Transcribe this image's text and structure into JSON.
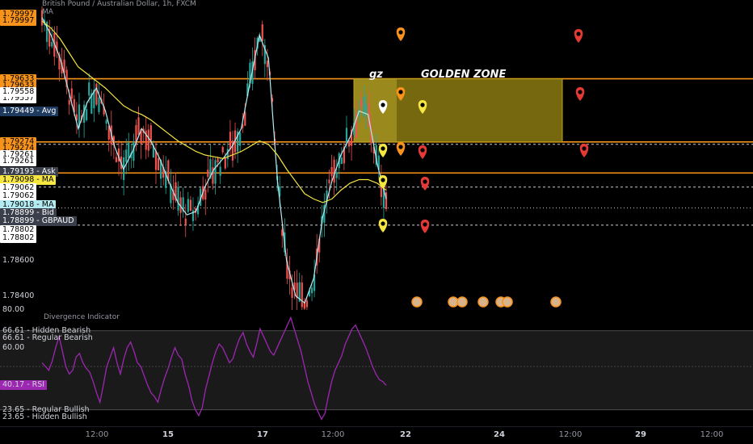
{
  "header": {
    "currency": "AUD",
    "symbol_line": "British Pound / Australian Dollar, 1h, FXCM",
    "ma_label": "MA"
  },
  "zone": {
    "short_label": "gz",
    "label": "GOLDEN ZONE",
    "fill": "#8a7a10",
    "border": "#f7931a"
  },
  "price_axis": {
    "labels": [
      {
        "text": "1.79997",
        "value": 1.79997,
        "bg": "#f7931a",
        "fg": "#000"
      },
      {
        "text": "1.79997",
        "value": 1.7996,
        "bg": "#f7931a",
        "fg": "#000"
      },
      {
        "text": "1.79633",
        "value": 1.79633,
        "bg": "#f7931a",
        "fg": "#000"
      },
      {
        "text": "1.79633",
        "value": 1.79596,
        "bg": "#f7931a",
        "fg": "#000"
      },
      {
        "text": "1.79557",
        "value": 1.7952,
        "bg": "#ffffff",
        "fg": "#000"
      },
      {
        "text": "1.79558",
        "value": 1.79558,
        "bg": "#ffffff",
        "fg": "#000"
      },
      {
        "text": "1.79449 - Avg",
        "value": 1.79449,
        "bg": "#1e3a5f",
        "fg": "#fff"
      },
      {
        "text": "1.79274",
        "value": 1.79274,
        "bg": "#f7931a",
        "fg": "#000"
      },
      {
        "text": "1.79274",
        "value": 1.79237,
        "bg": "#f7931a",
        "fg": "#000"
      },
      {
        "text": "1.79261",
        "value": 1.792,
        "bg": "#ffffff",
        "fg": "#000"
      },
      {
        "text": "1.79261",
        "value": 1.79163,
        "bg": "#ffffff",
        "fg": "#000"
      },
      {
        "text": "1.79193 - Ask",
        "value": 1.79105,
        "bg": "#3a3f4b",
        "fg": "#fff"
      },
      {
        "text": "1.79098 - MA",
        "value": 1.79058,
        "bg": "#f5e642",
        "fg": "#000"
      },
      {
        "text": "1.79062",
        "value": 1.79011,
        "bg": "#ffffff",
        "fg": "#000"
      },
      {
        "text": "1.79062",
        "value": 1.78964,
        "bg": "#ffffff",
        "fg": "#000"
      },
      {
        "text": "1.79018 - MA",
        "value": 1.78917,
        "bg": "#b2ebf2",
        "fg": "#000"
      },
      {
        "text": "1.78899 - Bid",
        "value": 1.7887,
        "bg": "#3a3f4b",
        "fg": "#fff"
      },
      {
        "text": "1.78899 - GBPAUD",
        "value": 1.78823,
        "bg": "#3a3f4b",
        "fg": "#fff"
      },
      {
        "text": "1.78802",
        "value": 1.78776,
        "bg": "#ffffff",
        "fg": "#000"
      },
      {
        "text": "1.78802",
        "value": 1.78729,
        "bg": "#ffffff",
        "fg": "#000"
      },
      {
        "text": "1.78600",
        "value": 1.786,
        "bg": "none",
        "fg": "#d1d4dc"
      },
      {
        "text": "1.78400",
        "value": 1.784,
        "bg": "none",
        "fg": "#d1d4dc"
      }
    ]
  },
  "rsi_panel": {
    "name": "Divergence Indicator",
    "labels": [
      {
        "text": "80.00",
        "value": 80
      },
      {
        "text": "66.61 - Hidden Bearish",
        "value": 69
      },
      {
        "text": "66.61 - Regular Bearish",
        "value": 65
      },
      {
        "text": "60.00",
        "value": 60
      },
      {
        "text": "40.17 - RSI",
        "value": 40.17,
        "bg": "#9c27b0"
      },
      {
        "text": "23.65 - Regular Bullish",
        "value": 27
      },
      {
        "text": "23.65 - Hidden Bullish",
        "value": 23
      }
    ]
  },
  "time_axis": {
    "ticks": [
      {
        "text": "12:00",
        "bold": false
      },
      {
        "text": "15",
        "bold": true
      },
      {
        "text": "17",
        "bold": true
      },
      {
        "text": "12:00",
        "bold": false
      },
      {
        "text": "22",
        "bold": true
      },
      {
        "text": "24",
        "bold": true
      },
      {
        "text": "12:00",
        "bold": false
      },
      {
        "text": "29",
        "bold": true
      },
      {
        "text": "12:00",
        "bold": false
      }
    ]
  },
  "chart_data": {
    "type": "line",
    "symbol": "GBPAUD",
    "ylim": [
      1.7832,
      1.8008
    ],
    "series": [
      {
        "name": "MA",
        "color": "#b2ebf2",
        "values": [
          1.7998,
          1.7988,
          1.7975,
          1.7955,
          1.7935,
          1.795,
          1.7958,
          1.7945,
          1.7925,
          1.7912,
          1.7922,
          1.7935,
          1.7928,
          1.7918,
          1.7905,
          1.7893,
          1.7886,
          1.7888,
          1.7902,
          1.7912,
          1.7918,
          1.7925,
          1.7935,
          1.7962,
          1.7988,
          1.7975,
          1.7905,
          1.786,
          1.784,
          1.7836,
          1.785,
          1.7885,
          1.7905,
          1.792,
          1.793,
          1.7945,
          1.7943,
          1.7915,
          1.7895
        ]
      },
      {
        "name": "MA",
        "color": "#f5e642",
        "values": [
          1.7996,
          1.7992,
          1.7986,
          1.7978,
          1.797,
          1.7966,
          1.7962,
          1.7958,
          1.7953,
          1.7948,
          1.7945,
          1.7943,
          1.794,
          1.7936,
          1.7932,
          1.7928,
          1.7925,
          1.7922,
          1.792,
          1.7919,
          1.7918,
          1.792,
          1.7922,
          1.7925,
          1.7928,
          1.7926,
          1.792,
          1.7912,
          1.7905,
          1.7898,
          1.7895,
          1.7893,
          1.7895,
          1.79,
          1.7904,
          1.7906,
          1.7906,
          1.7904,
          1.79
        ]
      }
    ],
    "levels": [
      {
        "value": 1.79633,
        "color": "#f7931a",
        "style": "solid"
      },
      {
        "value": 1.79274,
        "color": "#f7931a",
        "style": "solid"
      },
      {
        "value": 1.79098,
        "color": "#f7931a",
        "style": "solid"
      },
      {
        "value": 1.79261,
        "color": "#cccccc",
        "style": "dashed"
      },
      {
        "value": 1.79018,
        "color": "#cccccc",
        "style": "dashed"
      },
      {
        "value": 1.78899,
        "color": "#cccccc",
        "style": "dotted"
      },
      {
        "value": 1.78802,
        "color": "#cccccc",
        "style": "dashed"
      }
    ],
    "rsi": {
      "ylim": [
        20,
        80
      ],
      "values": [
        52,
        50,
        48,
        53,
        60,
        66,
        58,
        50,
        46,
        48,
        55,
        57,
        52,
        49,
        47,
        42,
        36,
        31,
        40,
        50,
        55,
        60,
        52,
        46,
        54,
        60,
        63,
        58,
        52,
        50,
        45,
        40,
        36,
        34,
        31,
        38,
        44,
        49,
        55,
        60,
        56,
        54,
        46,
        40,
        32,
        27,
        24,
        28,
        38,
        45,
        52,
        58,
        62,
        60,
        56,
        52,
        54,
        60,
        65,
        68,
        62,
        58,
        55,
        62,
        70,
        66,
        62,
        58,
        56,
        60,
        64,
        68,
        72,
        76,
        70,
        64,
        58,
        50,
        42,
        36,
        30,
        26,
        22,
        25,
        34,
        42,
        48,
        52,
        56,
        62,
        66,
        70,
        72,
        68,
        64,
        60,
        55,
        50,
        46,
        43,
        42,
        40
      ]
    }
  }
}
